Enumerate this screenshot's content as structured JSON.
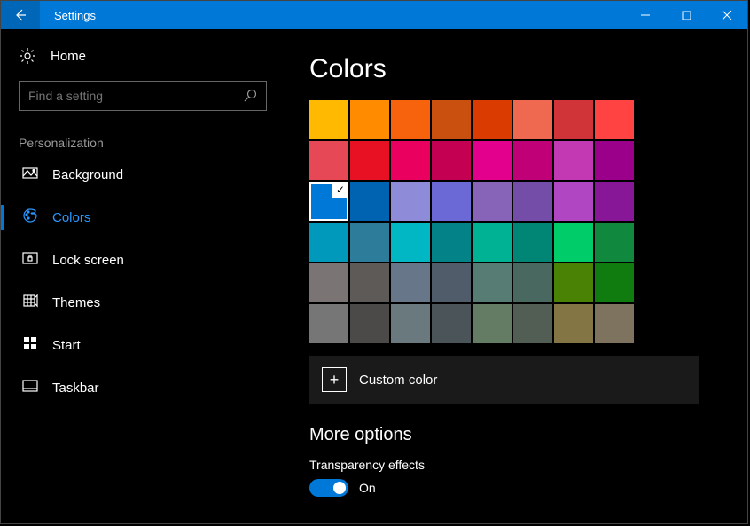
{
  "titlebar": {
    "title": "Settings"
  },
  "sidebar": {
    "home": "Home",
    "search_placeholder": "Find a setting",
    "section": "Personalization",
    "items": [
      {
        "label": "Background",
        "icon": "picture-icon",
        "active": false
      },
      {
        "label": "Colors",
        "icon": "palette-icon",
        "active": true
      },
      {
        "label": "Lock screen",
        "icon": "lock-icon",
        "active": false
      },
      {
        "label": "Themes",
        "icon": "themes-icon",
        "active": false
      },
      {
        "label": "Start",
        "icon": "start-icon",
        "active": false
      },
      {
        "label": "Taskbar",
        "icon": "taskbar-icon",
        "active": false
      }
    ]
  },
  "main": {
    "title": "Colors",
    "selected_index": 16,
    "swatches": [
      "#ffb900",
      "#ff8c00",
      "#f7630c",
      "#ca5010",
      "#da3b01",
      "#ef6950",
      "#d13438",
      "#ff4343",
      "#e74856",
      "#e81123",
      "#ea005e",
      "#c30052",
      "#e3008c",
      "#bf0077",
      "#c239b3",
      "#9a0089",
      "#0078d7",
      "#0063b1",
      "#8e8cd8",
      "#6b69d6",
      "#8764b8",
      "#744da9",
      "#b146c2",
      "#881798",
      "#0099bc",
      "#2d7d9a",
      "#00b7c3",
      "#038387",
      "#00b294",
      "#018574",
      "#00cc6a",
      "#10893e",
      "#7a7574",
      "#5d5a58",
      "#68768a",
      "#515c6b",
      "#567c73",
      "#486860",
      "#498205",
      "#107c10",
      "#767676",
      "#4c4a48",
      "#69797e",
      "#4a5459",
      "#647c64",
      "#525e54",
      "#847545",
      "#7e735f"
    ],
    "custom_label": "Custom color",
    "more_options": "More options",
    "transparency": {
      "label": "Transparency effects",
      "state": "On",
      "value": true
    }
  }
}
